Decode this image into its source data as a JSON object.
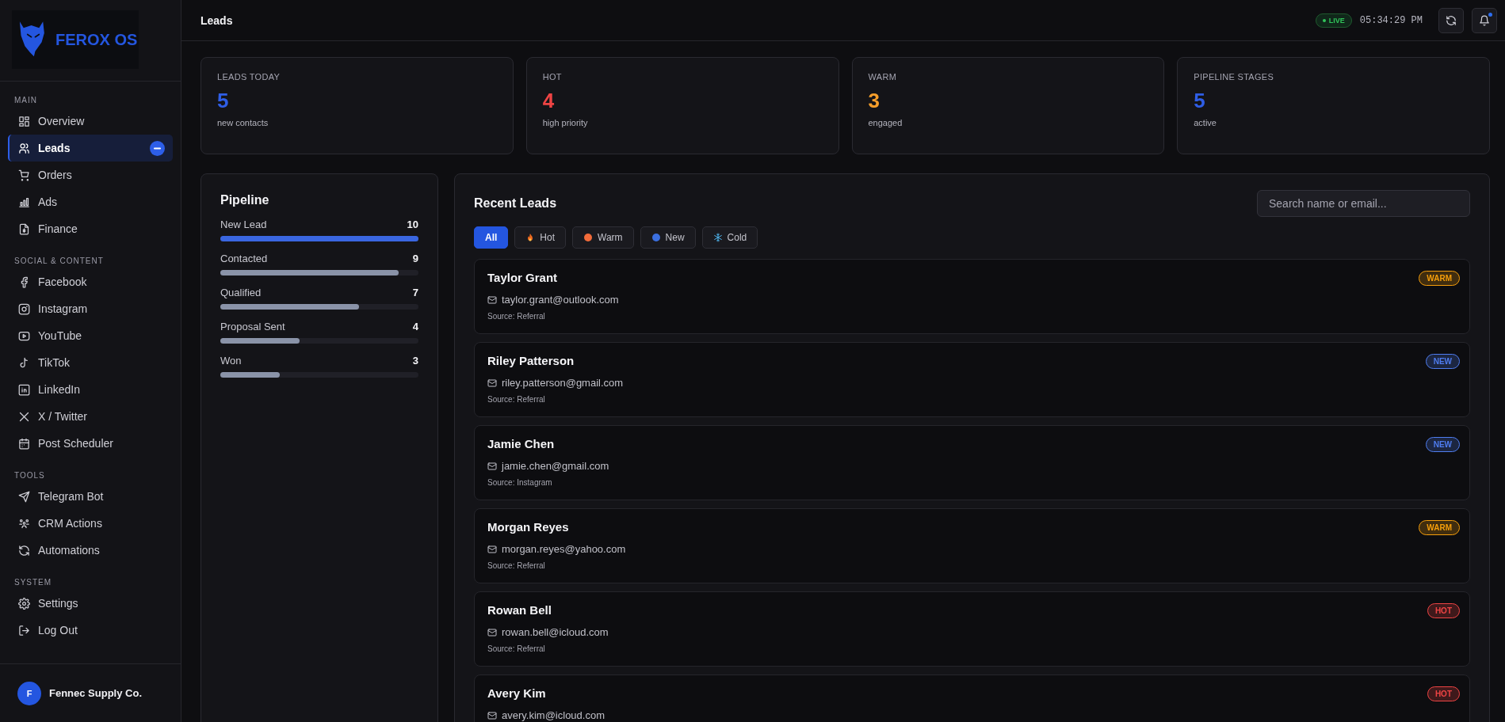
{
  "brand": {
    "name": "FEROX OS"
  },
  "sidebar": {
    "sections": [
      {
        "title": "MAIN",
        "items": [
          {
            "label": "Overview",
            "selected": false
          },
          {
            "label": "Leads",
            "selected": true
          },
          {
            "label": "Orders",
            "selected": false
          },
          {
            "label": "Ads",
            "selected": false
          },
          {
            "label": "Finance",
            "selected": false
          }
        ]
      },
      {
        "title": "SOCIAL & CONTENT",
        "items": [
          {
            "label": "Facebook",
            "selected": false
          },
          {
            "label": "Instagram",
            "selected": false
          },
          {
            "label": "YouTube",
            "selected": false
          },
          {
            "label": "TikTok",
            "selected": false
          },
          {
            "label": "LinkedIn",
            "selected": false
          },
          {
            "label": "X / Twitter",
            "selected": false
          },
          {
            "label": "Post Scheduler",
            "selected": false
          }
        ]
      },
      {
        "title": "TOOLS",
        "items": [
          {
            "label": "Telegram Bot",
            "selected": false
          },
          {
            "label": "CRM Actions",
            "selected": false
          },
          {
            "label": "Automations",
            "selected": false
          }
        ]
      },
      {
        "title": "SYSTEM",
        "items": [
          {
            "label": "Settings",
            "selected": false
          },
          {
            "label": "Log Out",
            "selected": false
          }
        ]
      }
    ],
    "account": {
      "initial": "F",
      "name": "Fennec Supply Co."
    }
  },
  "topbar": {
    "title": "Leads",
    "live": "LIVE",
    "time": "05:34:29 PM",
    "notification_dot": true
  },
  "stats": [
    {
      "label": "LEADS TODAY",
      "value": "5",
      "caption": "new contacts",
      "color": "#2f5ee6"
    },
    {
      "label": "HOT",
      "value": "4",
      "caption": "high priority",
      "color": "#ef4444"
    },
    {
      "label": "WARM",
      "value": "3",
      "caption": "engaged",
      "color": "#f59e2b"
    },
    {
      "label": "PIPELINE STAGES",
      "value": "5",
      "caption": "active",
      "color": "#2f5ee6"
    }
  ],
  "pipeline": {
    "title": "Pipeline",
    "stages": [
      {
        "label": "New Lead",
        "count": "10",
        "level": 1.0
      },
      {
        "label": "Contacted",
        "count": "9",
        "level": 0.9
      },
      {
        "label": "Qualified",
        "count": "7",
        "level": 0.7
      },
      {
        "label": "Proposal Sent",
        "count": "4",
        "level": 0.4
      },
      {
        "label": "Won",
        "count": "3",
        "level": 0.3
      }
    ]
  },
  "recent_leads": {
    "title": "Recent Leads",
    "search": {
      "placeholder": "Search name or email..."
    },
    "filters": [
      {
        "label": "All",
        "selected": true
      },
      {
        "label": "Hot",
        "selected": false
      },
      {
        "label": "Warm",
        "selected": false
      },
      {
        "label": "New",
        "selected": false
      },
      {
        "label": "Cold",
        "selected": false
      }
    ],
    "leads": [
      {
        "name": "Taylor Grant",
        "email": "taylor.grant@outlook.com",
        "source": "Source: Referral",
        "status": "WARM",
        "color": "#f59e0b"
      },
      {
        "name": "Riley Patterson",
        "email": "riley.patterson@gmail.com",
        "source": "Source: Referral",
        "status": "NEW",
        "color": "#4f7df0"
      },
      {
        "name": "Jamie Chen",
        "email": "jamie.chen@gmail.com",
        "source": "Source: Instagram",
        "status": "NEW",
        "color": "#4f7df0"
      },
      {
        "name": "Morgan Reyes",
        "email": "morgan.reyes@yahoo.com",
        "source": "Source: Referral",
        "status": "WARM",
        "color": "#f59e0b"
      },
      {
        "name": "Rowan Bell",
        "email": "rowan.bell@icloud.com",
        "source": "Source: Referral",
        "status": "HOT",
        "color": "#ef4444"
      },
      {
        "name": "Avery Kim",
        "email": "avery.kim@icloud.com",
        "status": "HOT",
        "color": "#ef4444"
      }
    ]
  }
}
